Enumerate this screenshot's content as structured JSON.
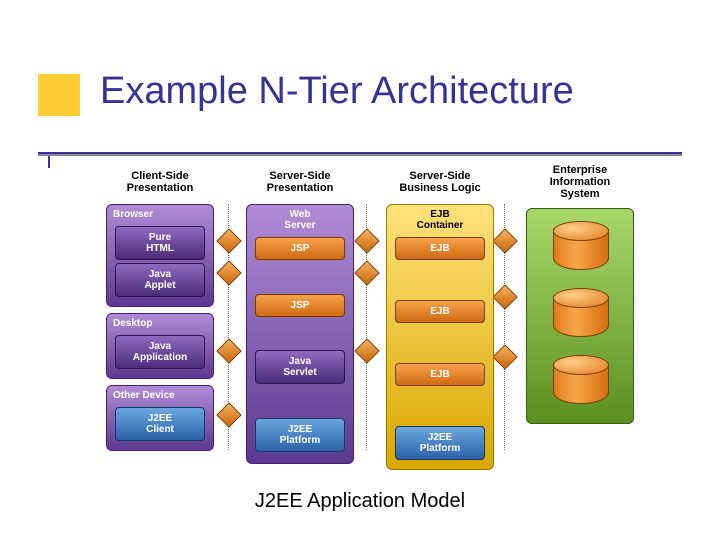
{
  "title": "Example N-Tier Architecture",
  "caption": "J2EE Application Model",
  "columns": [
    {
      "heading": "Client-Side\nPresentation",
      "sections": [
        {
          "label": "Browser",
          "boxes": [
            "Pure\nHTML",
            "Java\nApplet"
          ],
          "box_style": "purple"
        },
        {
          "label": "Desktop",
          "boxes": [
            "Java\nApplication"
          ],
          "box_style": "purple"
        },
        {
          "label": "Other Device",
          "boxes": [
            "J2EE\nClient"
          ],
          "box_style": "blue"
        }
      ]
    },
    {
      "heading": "Server-Side\nPresentation",
      "sections": [
        {
          "label": "Web\nServer",
          "boxes": [
            "JSP",
            "JSP",
            "Java\nServlet",
            "J2EE\nPlatform"
          ],
          "box_style_list": [
            "orange",
            "orange",
            "purple",
            "blue"
          ]
        }
      ]
    },
    {
      "heading": "Server-Side\nBusiness Logic",
      "container": "yellow",
      "sections": [
        {
          "label": "EJB\nContainer",
          "boxes": [
            "EJB",
            "EJB",
            "EJB",
            "J2EE\nPlatform"
          ],
          "box_style_list": [
            "orange",
            "orange",
            "orange",
            "blue"
          ]
        }
      ]
    },
    {
      "heading": "Enterprise\nInformation\nSystem",
      "container": "green",
      "cylinders": 3
    }
  ]
}
